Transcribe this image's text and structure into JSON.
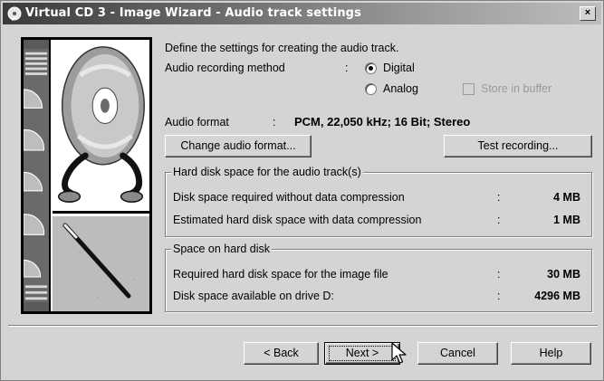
{
  "window": {
    "title": "Virtual CD 3 - Image Wizard - Audio track settings",
    "close_label": "×"
  },
  "intro": "Define the settings for creating the audio track.",
  "method": {
    "label": "Audio recording method",
    "colon": ":",
    "digital_label": "Digital",
    "analog_label": "Analog",
    "selected": "Digital",
    "store_buffer_label": "Store in buffer"
  },
  "audio_format": {
    "label": "Audio format",
    "colon": ":",
    "value": "PCM, 22,050 kHz; 16 Bit; Stereo"
  },
  "buttons": {
    "change_format": "Change audio format...",
    "test_recording": "Test recording...",
    "back": "< Back",
    "next": "Next >",
    "cancel": "Cancel",
    "help": "Help"
  },
  "audio_space": {
    "title": "Hard disk space for the audio track(s)",
    "rows": [
      {
        "label": "Disk space required without data compression",
        "colon": ":",
        "value": "4 MB"
      },
      {
        "label": "Estimated hard disk space with data compression",
        "colon": ":",
        "value": "1 MB"
      }
    ]
  },
  "disk_space": {
    "title": "Space on hard disk",
    "rows": [
      {
        "label": "Required hard disk space for the image file",
        "colon": ":",
        "value": "30 MB"
      },
      {
        "label": "Disk space available on drive D:",
        "colon": ":",
        "value": "4296 MB"
      }
    ]
  },
  "colors": {
    "dialog_bg": "#d4d4d4",
    "title_bar_dark": "#3a3a3a",
    "title_text": "#ffffff"
  }
}
